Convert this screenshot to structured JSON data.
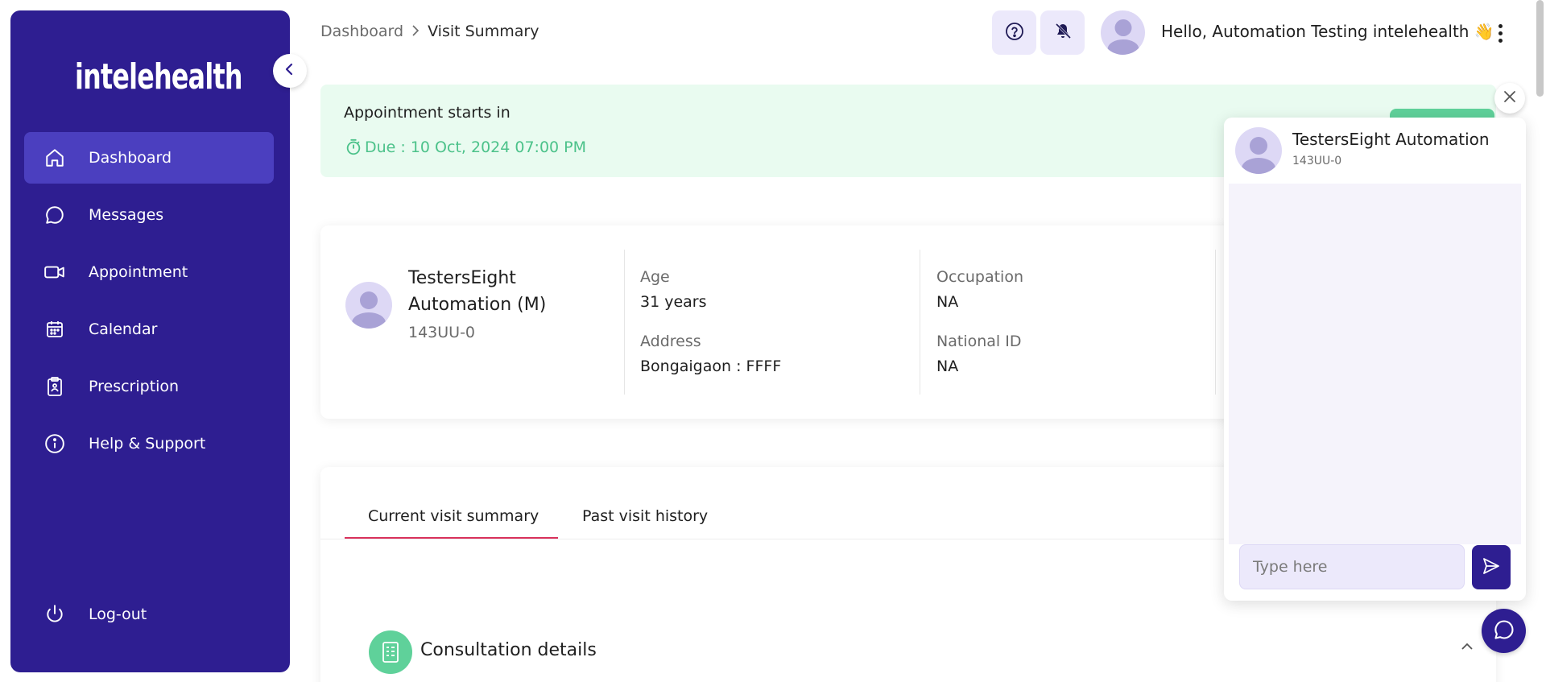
{
  "app": {
    "logo_text": "intelehealth",
    "colors": {
      "primary": "#2e1e91",
      "active_nav": "#4b3fbf",
      "accent_green": "#5fd19a",
      "tab_underline": "#d9325c"
    }
  },
  "sidebar": {
    "items": [
      {
        "label": "Dashboard",
        "icon": "home-icon",
        "active": true
      },
      {
        "label": "Messages",
        "icon": "chat-bubble-icon",
        "active": false
      },
      {
        "label": "Appointment",
        "icon": "video-icon",
        "active": false
      },
      {
        "label": "Calendar",
        "icon": "calendar-icon",
        "active": false
      },
      {
        "label": "Prescription",
        "icon": "clipboard-icon",
        "active": false
      },
      {
        "label": "Help & Support",
        "icon": "info-icon",
        "active": false
      }
    ],
    "logout_label": "Log-out"
  },
  "header": {
    "breadcrumb": [
      "Dashboard",
      "Visit Summary"
    ],
    "greeting": "Hello, Automation Testing intelehealth 👋"
  },
  "banner": {
    "title": "Appointment starts in",
    "due": "Due : 10 Oct, 2024 07:00 PM"
  },
  "patient": {
    "name": "TestersEight Automation (M)",
    "id": "143UU-0",
    "fields": [
      {
        "label": "Age",
        "value": "31 years"
      },
      {
        "label": "Address",
        "value": "Bongaigaon : FFFF"
      },
      {
        "label": "Occupation",
        "value": "NA"
      },
      {
        "label": "National ID",
        "value": "NA"
      }
    ]
  },
  "tabs": [
    {
      "label": "Current visit summary",
      "active": true
    },
    {
      "label": "Past visit history",
      "active": false
    }
  ],
  "consultation": {
    "title": "Consultation details"
  },
  "chat": {
    "name": "TestersEight Automation",
    "id": "143UU-0",
    "placeholder": "Type here"
  }
}
